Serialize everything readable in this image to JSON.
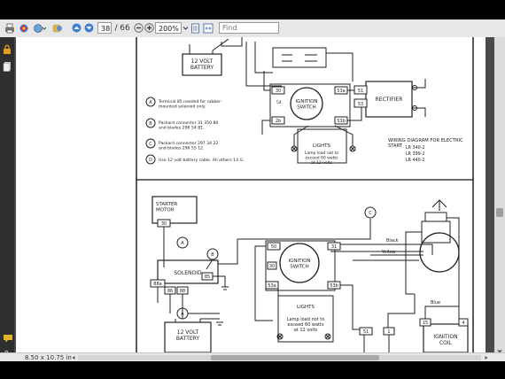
{
  "toolbar": {
    "page_current": "38",
    "page_separator": "/",
    "page_total": "66",
    "zoom": "200%",
    "find_placeholder": "Find"
  },
  "status": {
    "page_size": "8.50 x 10.75 in"
  },
  "diagram_top": {
    "battery": "12 VOLT\nBATTERY",
    "notes": [
      {
        "key": "A",
        "text": "Terminal 85 needed for rubber-\nmounted solenoid only."
      },
      {
        "key": "B",
        "text": "Packard connector 31 350 80\nand blades 296 54 81."
      },
      {
        "key": "C",
        "text": "Packard connector 297 34 22\nand blades 296 55 12."
      },
      {
        "key": "D",
        "text": "Use 12 volt battery cable.  All others 14 G."
      }
    ],
    "ignition_switch": "IGNITION\nSWITCH",
    "rectifier": "RECTIFIER",
    "lights": "LIGHTS",
    "lights_note": "Lamp load not to\nexceed 60 watts\nat 12 volts",
    "wiring_title": "WIRING DIAGRAM  FOR ELECTRIC\nSTART",
    "models": [
      "LR 340-2",
      "LR 399-2",
      "LR 440-2"
    ],
    "terminals": [
      "30",
      "53a",
      "51",
      "53",
      "2b",
      "54",
      "53b"
    ]
  },
  "diagram_bottom": {
    "starter_motor": "STARTER\nMOTOR",
    "solenoid": "SOLENOID",
    "ignition_switch": "IGNITION\nSWITCH",
    "lights": "LIGHTS",
    "lights_note": "Lamp load not to\nexceed 60 watts\nat 12 volts",
    "battery": "12 VOLT\nBATTERY",
    "ignition_coil": "IGNITION\nCOIL",
    "wire_black": "Black",
    "wire_yellow": "Yellow",
    "wire_blue": "Blue",
    "terminals": [
      "50",
      "31",
      "30",
      "53",
      "53a",
      "53b",
      "85",
      "86",
      "88a",
      "54",
      "51",
      "15",
      "4",
      "1"
    ],
    "callouts": [
      "A",
      "B",
      "C"
    ]
  }
}
